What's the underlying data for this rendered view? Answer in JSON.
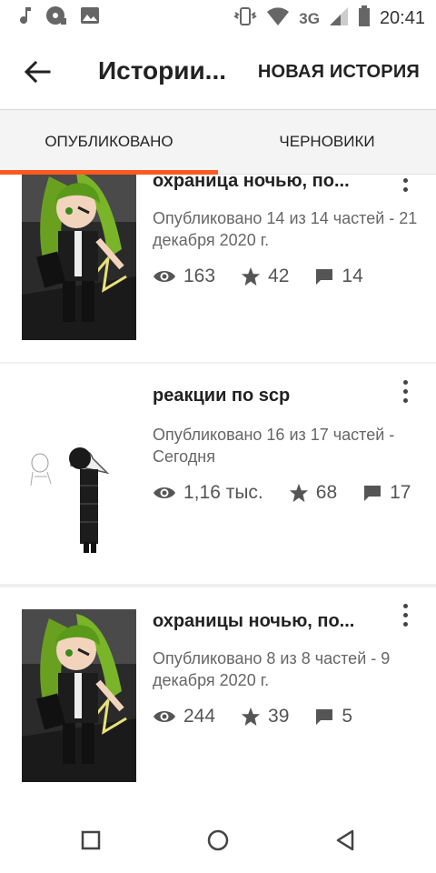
{
  "status_bar": {
    "network": "3G",
    "time": "20:41",
    "icons": [
      "music-note-icon",
      "disc-icon",
      "image-icon",
      "vibrate-icon",
      "wifi-icon",
      "signal-icon",
      "battery-icon"
    ]
  },
  "app_bar": {
    "back_icon": "back-arrow-icon",
    "title": "Истории...",
    "action_label": "НОВАЯ ИСТОРИЯ"
  },
  "tabs": [
    {
      "label": "ОПУБЛИКОВАНО",
      "active": true
    },
    {
      "label": "ЧЕРНОВИКИ",
      "active": false
    }
  ],
  "accent_color": "#ff5a1f",
  "stories": [
    {
      "title": "охраница ночью, по...",
      "meta": "Опубликовано 14 из 14 частей - 21 декабря 2020 г.",
      "views": "163",
      "votes": "42",
      "comments": "14"
    },
    {
      "title": "реакции по scp",
      "meta": "Опубликовано 16 из 17 частей - Сегодня",
      "views": "1,16 тыс.",
      "votes": "68",
      "comments": "17"
    },
    {
      "title": "охраницы ночью, по...",
      "meta": "Опубликовано 8 из 8 частей - 9 декабря 2020 г.",
      "views": "244",
      "votes": "39",
      "comments": "5"
    }
  ],
  "nav_bar": {
    "buttons": [
      "recent-apps-icon",
      "home-icon",
      "back-icon"
    ]
  }
}
